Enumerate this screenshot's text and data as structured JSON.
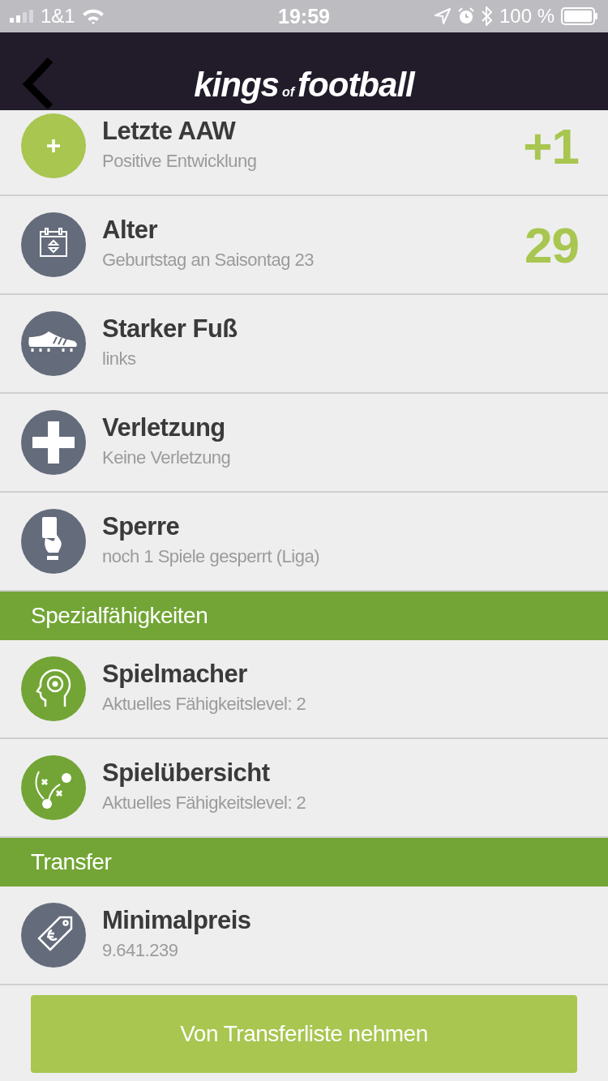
{
  "status_bar": {
    "carrier": "1&1",
    "time": "19:59",
    "battery": "100 %"
  },
  "header": {
    "logo": [
      "kings",
      "of",
      "football"
    ]
  },
  "rows": [
    {
      "kind": "plus",
      "color": "#a8c650",
      "title": "Letzte AAW",
      "subtitle": "Positive Entwicklung",
      "value": "+1"
    },
    {
      "kind": "calendar",
      "color": "#646b7b",
      "title": "Alter",
      "subtitle": "Geburtstag an Saisontag 23",
      "value": "29"
    },
    {
      "kind": "shoe",
      "color": "#646b7b",
      "title": "Starker Fuß",
      "subtitle": "links"
    },
    {
      "kind": "cross",
      "color": "#646b7b",
      "title": "Verletzung",
      "subtitle": "Keine Verletzung"
    },
    {
      "kind": "card",
      "color": "#646b7b",
      "title": "Sperre",
      "subtitle": "noch 1 Spiele gesperrt (Liga)"
    }
  ],
  "sections": [
    {
      "title": "Spezialfähigkeiten",
      "rows": [
        {
          "kind": "head",
          "color": "#72a535",
          "title": "Spielmacher",
          "subtitle": "Aktuelles Fähigkeitslevel: 2"
        },
        {
          "kind": "tactic",
          "color": "#72a535",
          "title": "Spielübersicht",
          "subtitle": "Aktuelles Fähigkeitslevel: 2"
        }
      ]
    },
    {
      "title": "Transfer",
      "rows": [
        {
          "kind": "tag",
          "color": "#646b7b",
          "title": "Minimalpreis",
          "subtitle": "9.641.239"
        }
      ]
    }
  ],
  "action_button": "Von Transferliste nehmen"
}
